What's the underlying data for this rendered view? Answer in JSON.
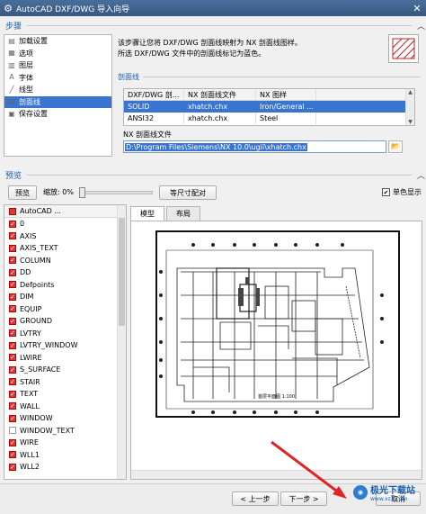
{
  "window": {
    "title": "AutoCAD DXF/DWG 导入向导",
    "close_glyph": "✕"
  },
  "steps_section": {
    "label": "步骤"
  },
  "steps": [
    {
      "label": "加载设置",
      "icon": "load-settings-icon"
    },
    {
      "label": "选项",
      "icon": "options-icon"
    },
    {
      "label": "图层",
      "icon": "layers-icon"
    },
    {
      "label": "字体",
      "icon": "font-icon"
    },
    {
      "label": "线型",
      "icon": "linetype-icon"
    },
    {
      "label": "剖面线",
      "icon": "hatch-icon",
      "selected": true
    },
    {
      "label": "保存设置",
      "icon": "save-settings-icon"
    }
  ],
  "description": {
    "line1": "该步骤让您将 DXF/DWG 剖面线映射为 NX 剖面线图样。",
    "line2": "所选 DXF/DWG 文件中的剖面线标记为蓝色。"
  },
  "hatch_section": {
    "label": "剖面线"
  },
  "hatch_table": {
    "headers": [
      "DXF/DWG 剖...",
      "NX 剖面线文件",
      "NX 图样",
      ""
    ],
    "rows": [
      {
        "dxf": "SOLID",
        "file": "xhatch.chx",
        "pattern": "Iron/General ...",
        "selected": true
      },
      {
        "dxf": "ANSI32",
        "file": "xhatch.chx",
        "pattern": "Steel",
        "selected": false
      }
    ]
  },
  "hatch_file": {
    "label": "NX 剖面线文件",
    "value": "D:\\Program Files\\Siemens\\NX 10.0\\ugii\\xhatch.chx"
  },
  "preview_section": {
    "label": "预览"
  },
  "preview_controls": {
    "preview_button": "预览",
    "zoom_label": "缩放: 0%",
    "zoom_value": 0,
    "fit_button": "等尺寸配对",
    "monochrome_label": "单色显示",
    "monochrome_checked": true
  },
  "layers": {
    "header": "AutoCAD ...",
    "items": [
      "0",
      "AXIS",
      "AXIS_TEXT",
      "COLUMN",
      "DD",
      "Defpoints",
      "DIM",
      "EQUIP",
      "GROUND",
      "LVTRY",
      "LVTRY_WINDOW",
      "LWIRE",
      "S_SURFACE",
      "STAIR",
      "TEXT",
      "WALL",
      "WINDOW",
      "WINDOW_TEXT",
      "WIRE",
      "WLL1",
      "WLL2"
    ],
    "checked": [
      true,
      true,
      true,
      true,
      true,
      true,
      true,
      true,
      true,
      true,
      true,
      true,
      true,
      true,
      true,
      true,
      true,
      false,
      true,
      true,
      true
    ]
  },
  "tabs": [
    {
      "label": "模型",
      "active": true
    },
    {
      "label": "布局",
      "active": false
    }
  ],
  "drawing": {
    "caption": "首层平面图  1:100"
  },
  "buttons": {
    "back": "< 上一步",
    "next": "下一步 >",
    "cancel": "取消"
  },
  "watermark": {
    "name": "极光下载站",
    "url": "www.xz7.com"
  },
  "colors": {
    "selection": "#3874d0",
    "accent": "#1e5fa8",
    "checkbox": "#d83a3a"
  }
}
